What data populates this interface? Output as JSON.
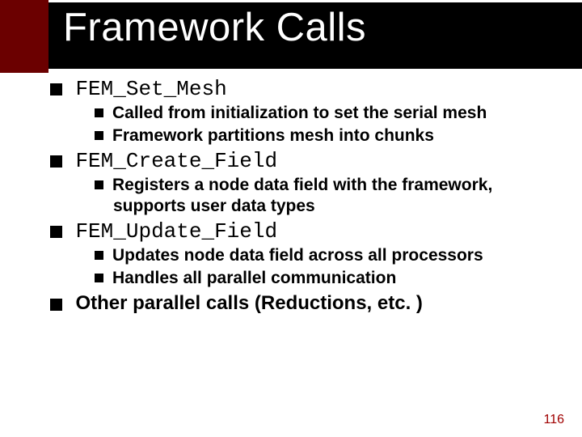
{
  "title": "Framework Calls",
  "items": [
    {
      "label": "FEM_Set_Mesh",
      "code": true,
      "subs": [
        "Called from initialization to set the serial mesh",
        "Framework partitions mesh into chunks"
      ]
    },
    {
      "label": "FEM_Create_Field",
      "code": true,
      "subs": [
        "Registers a node data field with the framework, supports user data types"
      ]
    },
    {
      "label": "FEM_Update_Field",
      "code": true,
      "subs": [
        "Updates node data field across all processors",
        "Handles all parallel communication"
      ]
    },
    {
      "label": "Other parallel calls (Reductions, etc. )",
      "code": false,
      "subs": []
    }
  ],
  "page_number": "116"
}
